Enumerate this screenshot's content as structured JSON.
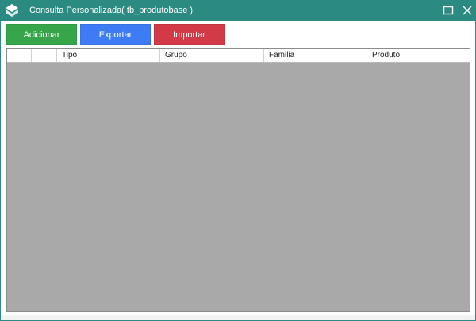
{
  "window": {
    "title": "Consulta Personalizada( tb_produtobase )",
    "app_icon": "app-logo-icon",
    "maximize_icon": "maximize-icon",
    "close_icon": "close-icon",
    "titlebar_color": "#2b8a81"
  },
  "toolbar": {
    "add_label": "Adicionar",
    "export_label": "Exportar",
    "import_label": "Importar",
    "add_color": "#37a64a",
    "export_color": "#3d7cf5",
    "import_color": "#d33a47"
  },
  "grid": {
    "columns": [
      "",
      "",
      "Tipo",
      "Grupo",
      "Familia",
      "Produto"
    ],
    "rows": [],
    "background_color": "#a9a9a9"
  }
}
